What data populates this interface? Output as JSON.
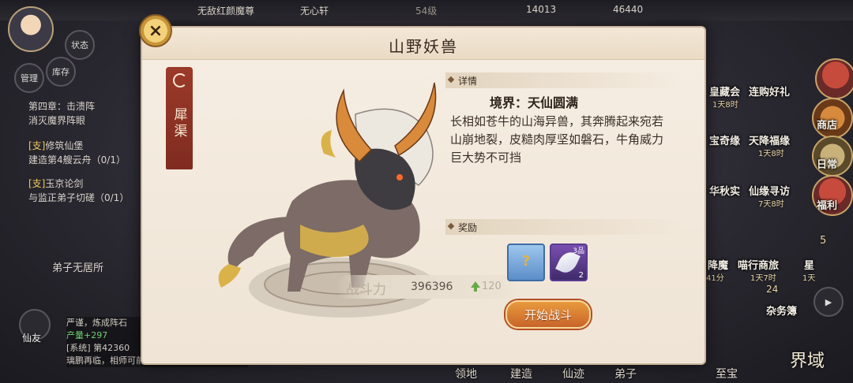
{
  "hud": {
    "top_left_title": "无敌红颜魔尊",
    "top_mid_title": "无心轩",
    "level": "54级",
    "currency1": "14013",
    "currency2": "46440",
    "badge_status": "状态",
    "badge_bag": "库存",
    "badge_manage": "管理"
  },
  "quests": [
    {
      "tag": "",
      "text": "第四章：击溃阵",
      "text2": "消灭魔界阵眼"
    },
    {
      "tag": "[支]",
      "text": "修筑仙堡",
      "text2": "建造第4艘云舟（0/1）"
    },
    {
      "tag": "[支]",
      "text": "玉京论剑",
      "text2": "与监正弟子切磋（0/1）"
    }
  ],
  "residence": "弟子无居所",
  "right_panel": [
    {
      "label": "皇藏会",
      "sub": "1天8时"
    },
    {
      "label": "连购好礼",
      "sub": ""
    },
    {
      "label": "商店",
      "sub": ""
    },
    {
      "label": "宝奇缘",
      "sub": ""
    },
    {
      "label": "天降福缘",
      "sub": "1天8时"
    },
    {
      "label": "日常",
      "sub": ""
    },
    {
      "label": "华秋实",
      "sub": ""
    },
    {
      "label": "仙缘寻访",
      "sub": "7天8时"
    },
    {
      "label": "福利",
      "sub": ""
    },
    {
      "label": "降魔",
      "sub": "41分"
    },
    {
      "label": "喵行商旅",
      "sub": "1天7时"
    },
    {
      "label": "星",
      "sub": "1天"
    },
    {
      "label": "杂务簿",
      "sub": ""
    }
  ],
  "right_badges": {
    "b1": "5",
    "b2": "24"
  },
  "bottom_nav": [
    "领地",
    "建造",
    "仙迹",
    "弟子",
    "至宝",
    "界域"
  ],
  "left_bottom": {
    "friends": "仙友"
  },
  "chat": [
    "严谨，炼成阵石",
    "产量+297",
    "[系统] 第42360",
    "璃鹏再临，相师可前往引仙台招募弟子"
  ],
  "dialog": {
    "title": "山野妖兽",
    "close_icon": "crab-close-icon",
    "beast_name": "犀渠",
    "power_label": "战斗力",
    "power_value": "396396",
    "power_delta": "120",
    "details_header": "详情",
    "realm": "境界：天仙圆满",
    "description": "长相如苍牛的山海异兽，其奔腾起来宛若山崩地裂，皮糙肉厚坚如磐石，牛角威力巨大势不可挡",
    "rewards_header": "奖励",
    "rewards": [
      {
        "name": "mystery-pill-icon",
        "grade": "",
        "count": ""
      },
      {
        "name": "feather-icon",
        "grade": "3品",
        "count": "2"
      }
    ],
    "start_button": "开始战斗",
    "colors": {
      "accent": "#c8642a",
      "tag": "#9c3a2a"
    }
  }
}
